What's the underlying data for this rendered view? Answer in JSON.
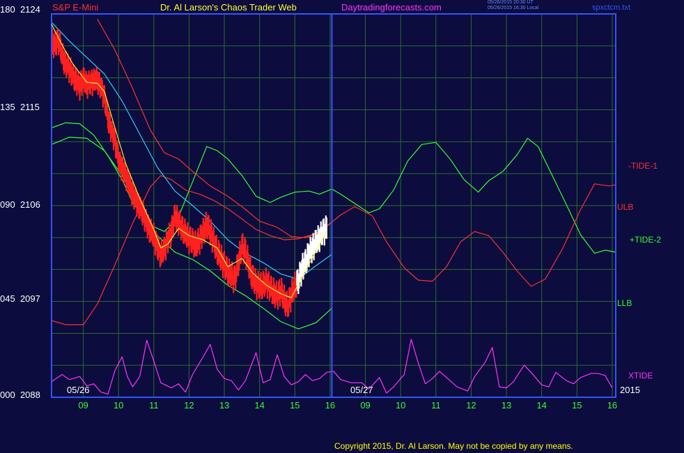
{
  "header": {
    "instrument": "S&P E-Mini",
    "title": "Dr. Al Larson's Chaos Trader Web",
    "site": "Daytradingforecasts.com",
    "stamp_line1": "05/26/2015 20:30 UT",
    "stamp_line2": "05/26/2015 16:30 Local",
    "file": "spxctcm.txt"
  },
  "copyright": "Copyright 2015, Dr. Al Larson. May not be copied by any means.",
  "colors": {
    "background": "#0c0c3e",
    "frame": "#3355ff",
    "grid": "#2c6b2c",
    "price_bar": "#ff2020",
    "price_bar_recent": "#ffffff",
    "yellow_avg": "#ffff33",
    "cyan_avg": "#33ccff",
    "tide1": "#ff3030",
    "tide2": "#33ff33",
    "xtide": "#ff33ff",
    "ulb": "#ff3030",
    "llb": "#33ff33"
  },
  "chart_data": {
    "type": "line",
    "y_labels": [
      {
        "left": "180",
        "right": "2124",
        "value": 2124
      },
      {
        "left": "135",
        "right": "2115",
        "value": 2115
      },
      {
        "left": "090",
        "right": "2106",
        "value": 2106
      },
      {
        "left": "045",
        "right": "2097",
        "value": 2097
      },
      {
        "left": "000",
        "right": "2088",
        "value": 2088
      }
    ],
    "ylim": [
      2088,
      2125
    ],
    "x_ticks": [
      "09",
      "10",
      "11",
      "12",
      "13",
      "14",
      "15",
      "16",
      "09",
      "10",
      "11",
      "12",
      "13",
      "14",
      "15",
      "16"
    ],
    "x_tick_hours": [
      8.9,
      9.9,
      10.9,
      11.9,
      12.9,
      13.9,
      14.9,
      15.9,
      16.9,
      17.9,
      18.9,
      19.9,
      20.9,
      21.9,
      22.9,
      23.9
    ],
    "xlim": [
      8.0,
      24.0
    ],
    "day_divider_hour": 15.95,
    "date_labels": {
      "day1": "05/26",
      "day2": "05/27",
      "year": "2015"
    },
    "series_labels": {
      "tide1": "-TIDE-1",
      "ulb": "ULB",
      "tide2": "+TIDE-2",
      "llb": "LLB",
      "xtide": "XTIDE"
    },
    "price_close": [
      [
        8.0,
        2122.3
      ],
      [
        8.1,
        2122.0
      ],
      [
        8.2,
        2122.5
      ],
      [
        8.3,
        2121.0
      ],
      [
        8.4,
        2120.2
      ],
      [
        8.5,
        2119.8
      ],
      [
        8.6,
        2119.0
      ],
      [
        8.7,
        2118.6
      ],
      [
        8.8,
        2118.0
      ],
      [
        8.9,
        2118.8
      ],
      [
        9.0,
        2118.2
      ],
      [
        9.1,
        2118.4
      ],
      [
        9.2,
        2118.6
      ],
      [
        9.3,
        2118.7
      ],
      [
        9.4,
        2118.0
      ],
      [
        9.5,
        2117.0
      ],
      [
        9.6,
        2115.0
      ],
      [
        9.7,
        2113.8
      ],
      [
        9.8,
        2112.8
      ],
      [
        9.9,
        2111.0
      ],
      [
        10.0,
        2110.2
      ],
      [
        10.1,
        2109.5
      ],
      [
        10.2,
        2108.6
      ],
      [
        10.3,
        2107.7
      ],
      [
        10.4,
        2107.0
      ],
      [
        10.5,
        2106.3
      ],
      [
        10.6,
        2105.8
      ],
      [
        10.7,
        2104.8
      ],
      [
        10.8,
        2104.1
      ],
      [
        10.9,
        2103.6
      ],
      [
        11.0,
        2102.5
      ],
      [
        11.1,
        2101.8
      ],
      [
        11.2,
        2102.3
      ],
      [
        11.3,
        2103.2
      ],
      [
        11.4,
        2104.0
      ],
      [
        11.5,
        2105.5
      ],
      [
        11.6,
        2105.0
      ],
      [
        11.7,
        2104.3
      ],
      [
        11.8,
        2103.8
      ],
      [
        11.9,
        2103.3
      ],
      [
        12.0,
        2103.0
      ],
      [
        12.1,
        2102.6
      ],
      [
        12.2,
        2103.2
      ],
      [
        12.3,
        2103.9
      ],
      [
        12.4,
        2104.6
      ],
      [
        12.5,
        2104.0
      ],
      [
        12.6,
        2103.0
      ],
      [
        12.7,
        2102.1
      ],
      [
        12.8,
        2101.4
      ],
      [
        12.9,
        2100.7
      ],
      [
        13.0,
        2100.1
      ],
      [
        13.1,
        2099.7
      ],
      [
        13.2,
        2099.4
      ],
      [
        13.3,
        2101.0
      ],
      [
        13.4,
        2102.5
      ],
      [
        13.5,
        2102.0
      ],
      [
        13.6,
        2100.7
      ],
      [
        13.7,
        2099.5
      ],
      [
        13.8,
        2098.9
      ],
      [
        13.9,
        2098.6
      ],
      [
        14.0,
        2098.8
      ],
      [
        14.1,
        2099.1
      ],
      [
        14.2,
        2098.5
      ],
      [
        14.3,
        2098.1
      ],
      [
        14.4,
        2097.7
      ],
      [
        14.5,
        2098.3
      ],
      [
        14.6,
        2097.4
      ],
      [
        14.7,
        2096.8
      ],
      [
        14.8,
        2097.9
      ],
      [
        14.9,
        2098.7
      ],
      [
        15.0,
        2099.2
      ],
      [
        15.1,
        2100.4
      ],
      [
        15.2,
        2101.0
      ],
      [
        15.3,
        2101.9
      ],
      [
        15.4,
        2102.4
      ],
      [
        15.5,
        2103.0
      ],
      [
        15.6,
        2103.4
      ],
      [
        15.7,
        2104.0
      ],
      [
        15.8,
        2104.3
      ]
    ],
    "price_range": 0.55,
    "recent_from_hour": 14.95,
    "yellow_avg": [
      [
        8.0,
        2124.0
      ],
      [
        8.3,
        2122.0
      ],
      [
        8.6,
        2120.2
      ],
      [
        9.0,
        2118.4
      ],
      [
        9.3,
        2118.3
      ],
      [
        9.5,
        2117.5
      ],
      [
        9.8,
        2114.0
      ],
      [
        10.1,
        2110.6
      ],
      [
        10.5,
        2107.2
      ],
      [
        10.9,
        2104.2
      ],
      [
        11.1,
        2102.4
      ],
      [
        11.3,
        2102.8
      ],
      [
        11.6,
        2104.3
      ],
      [
        11.9,
        2103.6
      ],
      [
        12.3,
        2103.2
      ],
      [
        12.7,
        2102.4
      ],
      [
        13.0,
        2100.6
      ],
      [
        13.4,
        2101.4
      ],
      [
        13.7,
        2100.0
      ],
      [
        14.1,
        2098.8
      ],
      [
        14.5,
        2098.0
      ],
      [
        14.8,
        2097.6
      ],
      [
        15.1,
        2099.6
      ],
      [
        15.5,
        2102.1
      ],
      [
        15.8,
        2104.0
      ]
    ],
    "cyan_avg": [
      [
        8.0,
        2124.2
      ],
      [
        8.5,
        2122.4
      ],
      [
        9.0,
        2120.8
      ],
      [
        9.5,
        2119.2
      ],
      [
        10.0,
        2116.6
      ],
      [
        10.5,
        2113.4
      ],
      [
        11.0,
        2110.2
      ],
      [
        11.5,
        2107.9
      ],
      [
        12.0,
        2106.5
      ],
      [
        12.5,
        2105.0
      ],
      [
        13.0,
        2103.2
      ],
      [
        13.5,
        2101.9
      ],
      [
        14.0,
        2101.0
      ],
      [
        14.5,
        2099.9
      ],
      [
        15.0,
        2099.4
      ],
      [
        15.5,
        2100.7
      ],
      [
        15.95,
        2101.8
      ]
    ],
    "ulb": [
      [
        9.3,
        2124.5
      ],
      [
        9.8,
        2121.5
      ],
      [
        10.3,
        2117.8
      ],
      [
        10.8,
        2113.8
      ],
      [
        11.2,
        2111.6
      ],
      [
        11.6,
        2111.0
      ],
      [
        12.0,
        2109.8
      ],
      [
        12.5,
        2108.4
      ],
      [
        13.0,
        2107.4
      ],
      [
        13.4,
        2106.4
      ],
      [
        13.9,
        2105.0
      ],
      [
        14.4,
        2104.4
      ],
      [
        14.8,
        2103.5
      ],
      [
        15.2,
        2103.4
      ],
      [
        15.6,
        2103.9
      ],
      [
        15.95,
        2104.9
      ]
    ],
    "tide1_first": [
      [
        8.0,
        2095.4
      ],
      [
        8.4,
        2095.0
      ],
      [
        8.9,
        2095.0
      ],
      [
        9.3,
        2097.0
      ],
      [
        9.8,
        2100.8
      ],
      [
        10.3,
        2104.8
      ],
      [
        10.8,
        2108.3
      ],
      [
        11.1,
        2109.4
      ],
      [
        11.4,
        2109.0
      ],
      [
        11.8,
        2108.0
      ],
      [
        12.2,
        2107.6
      ],
      [
        12.6,
        2107.0
      ],
      [
        13.0,
        2106.2
      ],
      [
        13.4,
        2105.2
      ],
      [
        13.8,
        2104.2
      ],
      [
        14.2,
        2103.6
      ],
      [
        14.6,
        2103.2
      ],
      [
        15.0,
        2103.3
      ],
      [
        15.5,
        2103.8
      ],
      [
        15.95,
        2104.9
      ]
    ],
    "tide1_second": [
      [
        15.95,
        2104.9
      ],
      [
        16.2,
        2105.6
      ],
      [
        16.6,
        2106.4
      ],
      [
        17.1,
        2105.5
      ],
      [
        17.5,
        2103.0
      ],
      [
        18.0,
        2100.5
      ],
      [
        18.4,
        2099.3
      ],
      [
        18.8,
        2099.2
      ],
      [
        19.2,
        2100.6
      ],
      [
        19.6,
        2103.0
      ],
      [
        20.0,
        2104.0
      ],
      [
        20.4,
        2103.6
      ],
      [
        20.8,
        2102.0
      ],
      [
        21.2,
        2100.2
      ],
      [
        21.6,
        2098.7
      ],
      [
        22.0,
        2099.4
      ],
      [
        22.5,
        2102.4
      ],
      [
        23.0,
        2106.1
      ],
      [
        23.4,
        2108.6
      ],
      [
        23.8,
        2108.4
      ],
      [
        24.0,
        2108.5
      ]
    ],
    "tide2_first": [
      [
        8.0,
        2114.0
      ],
      [
        8.4,
        2114.5
      ],
      [
        8.8,
        2114.4
      ],
      [
        9.2,
        2113.3
      ],
      [
        9.6,
        2111.3
      ],
      [
        10.0,
        2109.0
      ],
      [
        10.3,
        2106.8
      ],
      [
        10.8,
        2104.6
      ],
      [
        11.2,
        2104.0
      ],
      [
        11.6,
        2105.4
      ],
      [
        12.0,
        2108.8
      ],
      [
        12.4,
        2112.2
      ],
      [
        12.7,
        2111.8
      ],
      [
        13.0,
        2111.0
      ],
      [
        13.4,
        2109.4
      ],
      [
        13.8,
        2107.4
      ],
      [
        14.2,
        2106.8
      ],
      [
        14.5,
        2107.3
      ],
      [
        14.9,
        2107.8
      ],
      [
        15.3,
        2107.9
      ],
      [
        15.6,
        2107.6
      ],
      [
        15.95,
        2108.1
      ]
    ],
    "tide2_second": [
      [
        15.95,
        2108.1
      ],
      [
        16.2,
        2107.6
      ],
      [
        16.6,
        2106.7
      ],
      [
        17.0,
        2105.8
      ],
      [
        17.3,
        2106.2
      ],
      [
        17.7,
        2108.0
      ],
      [
        18.1,
        2110.8
      ],
      [
        18.5,
        2112.4
      ],
      [
        18.9,
        2112.6
      ],
      [
        19.3,
        2111.0
      ],
      [
        19.7,
        2109.0
      ],
      [
        20.1,
        2107.8
      ],
      [
        20.4,
        2108.9
      ],
      [
        20.8,
        2109.8
      ],
      [
        21.2,
        2111.4
      ],
      [
        21.5,
        2113.0
      ],
      [
        21.8,
        2112.2
      ],
      [
        22.2,
        2109.4
      ],
      [
        22.6,
        2106.6
      ],
      [
        23.0,
        2103.7
      ],
      [
        23.4,
        2101.9
      ],
      [
        23.7,
        2102.2
      ],
      [
        24.0,
        2102.0
      ]
    ],
    "llb": [
      [
        8.0,
        2112.4
      ],
      [
        8.5,
        2113.1
      ],
      [
        9.0,
        2113.0
      ],
      [
        9.5,
        2111.8
      ],
      [
        10.0,
        2109.4
      ],
      [
        10.5,
        2106.5
      ],
      [
        11.0,
        2103.6
      ],
      [
        11.5,
        2102.0
      ],
      [
        12.0,
        2101.3
      ],
      [
        12.5,
        2100.2
      ],
      [
        13.0,
        2098.8
      ],
      [
        13.5,
        2097.8
      ],
      [
        14.0,
        2096.6
      ],
      [
        14.5,
        2095.3
      ],
      [
        15.0,
        2094.6
      ],
      [
        15.5,
        2095.2
      ],
      [
        15.95,
        2096.6
      ]
    ],
    "xtide": [
      [
        8.0,
        2089.5
      ],
      [
        8.3,
        2090.2
      ],
      [
        8.5,
        2089.7
      ],
      [
        8.8,
        2090.0
      ],
      [
        9.0,
        2089.1
      ],
      [
        9.2,
        2089.3
      ],
      [
        9.4,
        2088.5
      ],
      [
        9.6,
        2088.3
      ],
      [
        9.8,
        2090.6
      ],
      [
        10.0,
        2091.9
      ],
      [
        10.15,
        2090.0
      ],
      [
        10.3,
        2089.0
      ],
      [
        10.5,
        2090.0
      ],
      [
        10.7,
        2093.5
      ],
      [
        10.9,
        2091.5
      ],
      [
        11.1,
        2089.4
      ],
      [
        11.4,
        2088.9
      ],
      [
        11.6,
        2089.3
      ],
      [
        11.8,
        2088.5
      ],
      [
        12.0,
        2090.2
      ],
      [
        12.3,
        2091.9
      ],
      [
        12.5,
        2093.1
      ],
      [
        12.7,
        2090.7
      ],
      [
        12.9,
        2089.8
      ],
      [
        13.1,
        2089.6
      ],
      [
        13.3,
        2088.7
      ],
      [
        13.5,
        2089.6
      ],
      [
        13.8,
        2092.3
      ],
      [
        14.0,
        2089.4
      ],
      [
        14.2,
        2089.7
      ],
      [
        14.4,
        2092.1
      ],
      [
        14.6,
        2090.0
      ],
      [
        14.8,
        2089.2
      ],
      [
        15.0,
        2089.5
      ],
      [
        15.2,
        2090.2
      ],
      [
        15.4,
        2089.6
      ],
      [
        15.6,
        2089.8
      ],
      [
        15.8,
        2090.4
      ],
      [
        16.0,
        2090.5
      ],
      [
        16.2,
        2089.7
      ],
      [
        16.5,
        2089.4
      ],
      [
        16.8,
        2089.4
      ],
      [
        17.0,
        2088.8
      ],
      [
        17.3,
        2089.9
      ],
      [
        17.5,
        2088.4
      ],
      [
        17.7,
        2089.0
      ],
      [
        18.0,
        2090.2
      ],
      [
        18.2,
        2093.6
      ],
      [
        18.4,
        2091.3
      ],
      [
        18.6,
        2089.3
      ],
      [
        18.8,
        2089.8
      ],
      [
        19.0,
        2090.5
      ],
      [
        19.3,
        2089.6
      ],
      [
        19.5,
        2089.0
      ],
      [
        19.8,
        2088.6
      ],
      [
        20.0,
        2090.0
      ],
      [
        20.3,
        2091.4
      ],
      [
        20.5,
        2092.8
      ],
      [
        20.7,
        2089.0
      ],
      [
        20.9,
        2088.9
      ],
      [
        21.1,
        2089.5
      ],
      [
        21.4,
        2091.1
      ],
      [
        21.6,
        2090.4
      ],
      [
        21.9,
        2089.2
      ],
      [
        22.1,
        2089.0
      ],
      [
        22.3,
        2090.4
      ],
      [
        22.6,
        2089.6
      ],
      [
        22.8,
        2089.3
      ],
      [
        23.0,
        2089.9
      ],
      [
        23.3,
        2090.3
      ],
      [
        23.5,
        2090.3
      ],
      [
        23.7,
        2090.1
      ],
      [
        23.9,
        2088.9
      ]
    ]
  }
}
